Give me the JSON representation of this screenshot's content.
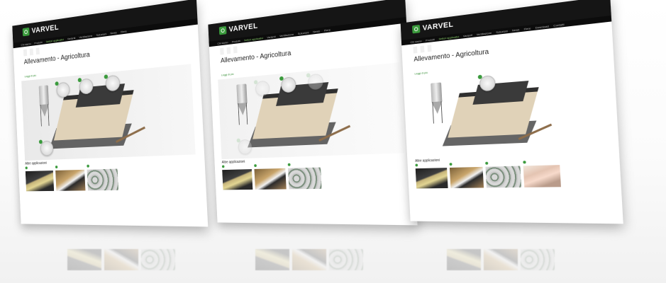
{
  "brand": {
    "name": "VARVEL",
    "accent": "#3a9a3c"
  },
  "nav": {
    "items": [
      "Chi siamo",
      "Prodotti",
      "Settori applicativi",
      "Varianti",
      "Ventilazione",
      "Soluzioni",
      "News",
      "Fiere",
      "Download",
      "Contatti"
    ]
  },
  "page": {
    "title": "Allevamento - Agricoltura",
    "more_link": "Leggi di più",
    "other_apps_title": "Altre applicazioni"
  },
  "panels": [
    {
      "id": "p1",
      "robots": 4
    },
    {
      "id": "p2",
      "robots": 4
    },
    {
      "id": "p3",
      "robots": 1
    }
  ],
  "icons": {
    "logo": "logo-mark-icon",
    "robot_marker": "location-dot-icon"
  }
}
